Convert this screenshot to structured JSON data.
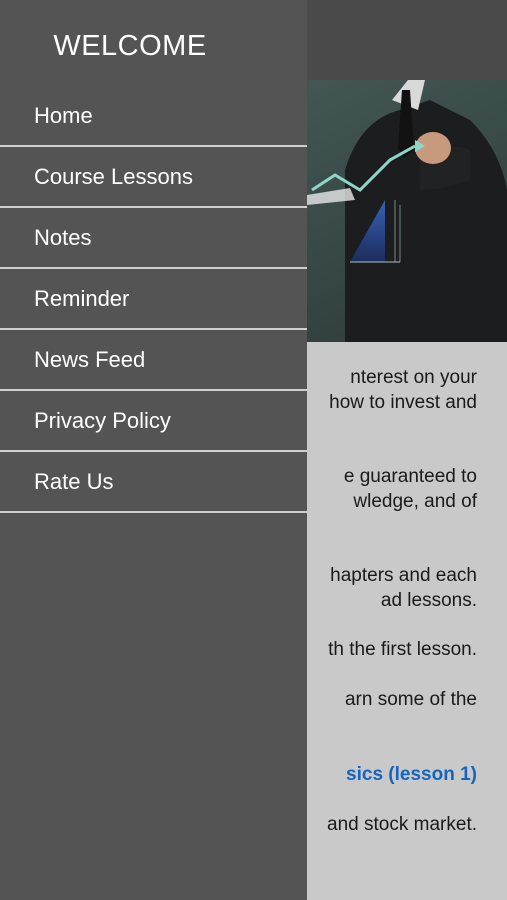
{
  "drawer": {
    "title": "WELCOME",
    "items": [
      {
        "label": "Home"
      },
      {
        "label": "Course Lessons"
      },
      {
        "label": "Notes"
      },
      {
        "label": "Reminder"
      },
      {
        "label": "News Feed"
      },
      {
        "label": "Privacy Policy"
      },
      {
        "label": "Rate Us"
      }
    ]
  },
  "content": {
    "lines": [
      "nterest on your",
      " how to invest and",
      "e guaranteed to",
      "wledge, and of",
      "hapters and each",
      "ad lessons.",
      "th the first lesson.",
      "arn some of the",
      "sics (lesson 1)",
      " and stock market."
    ]
  },
  "colors": {
    "drawer_bg": "#545454",
    "topbar_bg": "#4a4a4a",
    "content_bg": "#c9c9c9",
    "link": "#1565c0"
  }
}
